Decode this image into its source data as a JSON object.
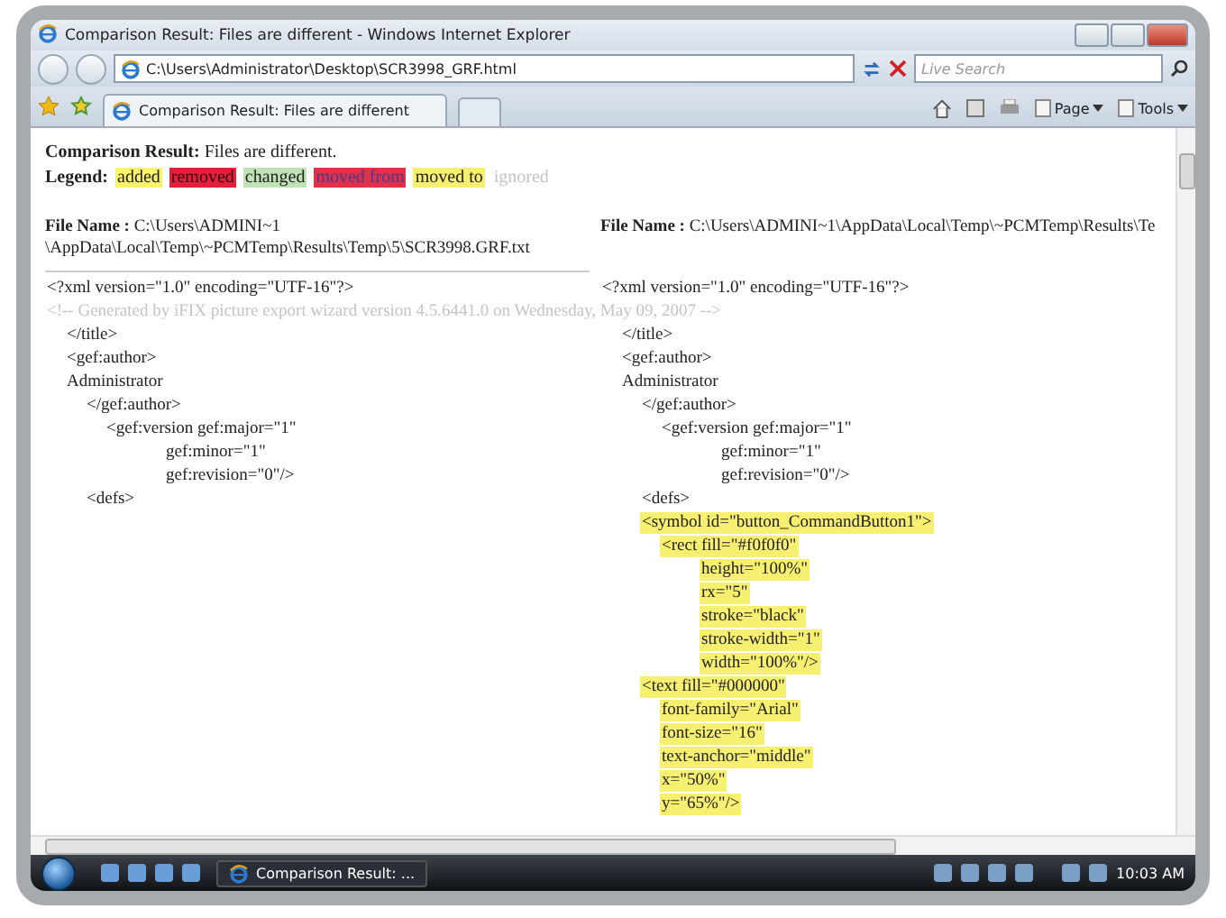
{
  "window": {
    "title": "Comparison Result: Files are different - Windows Internet Explorer"
  },
  "address_bar": {
    "value": "C:\\Users\\Administrator\\Desktop\\SCR3998_GRF.html"
  },
  "search": {
    "placeholder": "Live Search"
  },
  "tabs": [
    {
      "label": "Comparison Result: Files are different",
      "selected": true
    }
  ],
  "toolbar": {
    "items": [
      "Page",
      "Tools"
    ]
  },
  "page": {
    "result_label": "Comparison Result:",
    "result_text": "Files are different.",
    "legend_label": "Legend:",
    "legend": [
      {
        "label": "added",
        "kind": "added"
      },
      {
        "label": "removed",
        "kind": "removed"
      },
      {
        "label": "changed",
        "kind": "changed"
      },
      {
        "label": "moved from",
        "kind": "moved_from"
      },
      {
        "label": "moved to",
        "kind": "moved_to"
      },
      {
        "label": "ignored",
        "kind": "ignored"
      }
    ],
    "columns": [
      {
        "file_label": "File Name :",
        "file_path": "C:\\Users\\ADMINI~1 \\AppData\\Local\\Temp\\~PCMTemp\\Results\\Temp\\5\\SCR3998.GRF.txt",
        "lines": [
          {
            "text": "<?xml version=\"1.0\" encoding=\"UTF-16\"?>",
            "kind": "normal"
          },
          {
            "text": "<!-- Generated by iFIX picture export wizard version 4.5.6441.0 on Wednesday, May 09, 2007 -->",
            "kind": "ignored"
          },
          {
            "children": [
              {
                "text": "</title>",
                "kind": "normal"
              },
              {
                "text": "<gef:author>",
                "kind": "normal"
              },
              {
                "text": "Administrator",
                "kind": "normal"
              },
              {
                "children": [
                  {
                    "text": "</gef:author>",
                    "kind": "normal"
                  },
                  {
                    "children": [
                      {
                        "text": "<gef:version gef:major=\"1\"",
                        "kind": "normal",
                        "children": [
                          {
                            "children": [
                              {
                                "children": [
                                  {
                                    "text": "gef:minor=\"1\"",
                                    "kind": "normal"
                                  },
                                  {
                                    "text": "gef:revision=\"0\"/>",
                                    "kind": "normal"
                                  }
                                ]
                              }
                            ]
                          }
                        ]
                      }
                    ]
                  },
                  {
                    "text": "<defs>",
                    "kind": "normal"
                  }
                ]
              }
            ]
          }
        ]
      },
      {
        "file_label": "File Name :",
        "file_path": "C:\\Users\\ADMINI~1\\AppData\\Local\\Temp\\~PCMTemp\\Results\\Te",
        "lines": [
          {
            "text": "<?xml version=\"1.0\" encoding=\"UTF-16\"?>",
            "kind": "normal"
          },
          {
            "children": [
              {
                "text": "</title>",
                "kind": "normal"
              },
              {
                "text": "<gef:author>",
                "kind": "normal"
              },
              {
                "text": "Administrator",
                "kind": "normal"
              },
              {
                "children": [
                  {
                    "text": "</gef:author>",
                    "kind": "normal"
                  },
                  {
                    "children": [
                      {
                        "text": "<gef:version gef:major=\"1\"",
                        "kind": "normal",
                        "children": [
                          {
                            "children": [
                              {
                                "children": [
                                  {
                                    "text": "gef:minor=\"1\"",
                                    "kind": "normal"
                                  },
                                  {
                                    "text": "gef:revision=\"0\"/>",
                                    "kind": "normal"
                                  }
                                ]
                              }
                            ]
                          }
                        ]
                      }
                    ]
                  },
                  {
                    "text": "<defs>",
                    "kind": "normal"
                  },
                  {
                    "text": "<symbol id=\"button_CommandButton1\">",
                    "kind": "moved_to"
                  },
                  {
                    "children": [
                      {
                        "text": "<rect fill=\"#f0f0f0\"",
                        "kind": "moved_to",
                        "children": [
                          {
                            "children": [
                              {
                                "text": "height=\"100%\"",
                                "kind": "moved_to"
                              },
                              {
                                "text": "rx=\"5\"",
                                "kind": "moved_to"
                              },
                              {
                                "text": "stroke=\"black\"",
                                "kind": "moved_to"
                              },
                              {
                                "text": "stroke-width=\"1\"",
                                "kind": "moved_to"
                              },
                              {
                                "text": "width=\"100%\"/>",
                                "kind": "moved_to"
                              }
                            ]
                          }
                        ]
                      }
                    ]
                  },
                  {
                    "text": "<text fill=\"#000000\"",
                    "kind": "moved_to",
                    "children": [
                      {
                        "text": "font-family=\"Arial\"",
                        "kind": "moved_to"
                      },
                      {
                        "text": "font-size=\"16\"",
                        "kind": "moved_to"
                      },
                      {
                        "text": "text-anchor=\"middle\"",
                        "kind": "moved_to"
                      },
                      {
                        "text": "x=\"50%\"",
                        "kind": "moved_to"
                      },
                      {
                        "text": "y=\"65%\"/>",
                        "kind": "moved_to"
                      }
                    ]
                  }
                ]
              }
            ]
          }
        ]
      }
    ]
  },
  "taskbar": {
    "task": "Comparison Result: ...",
    "clock": "10:03 AM"
  }
}
